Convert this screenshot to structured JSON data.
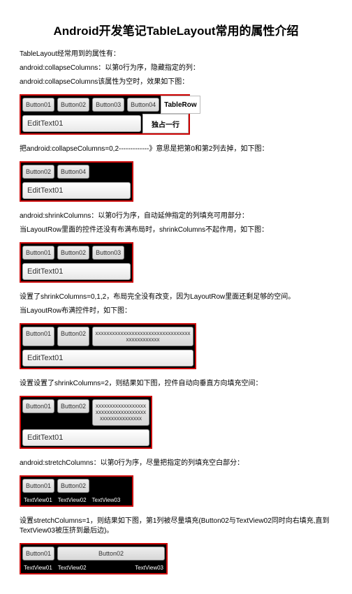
{
  "title": "Android开发笔记TableLayout常用的属性介绍",
  "p1": "TableLayout经常用到的属性有：",
  "p2": "android:collapseColumns：以第0行为序，隐藏指定的列：",
  "p3": "android:collapseColumns该属性为空时，效果如下图：",
  "demo1": {
    "btns": [
      "Button01",
      "Button02",
      "Button03",
      "Button04"
    ],
    "side1": "TableRow",
    "edit": "EditText01",
    "side2": "独占一行"
  },
  "p4": "把android:collapseColumns=0,2-------------》意思是把第0和第2列去掉，如下图：",
  "demo2": {
    "btns": [
      "Button02",
      "Button04"
    ],
    "edit": "EditText01"
  },
  "p5": "android:shrinkColumns：以第0行为序，自动延伸指定的列填充可用部分：",
  "p6": "当LayoutRow里面的控件还没有布满布局时，shrinkColumns不起作用，如下图：",
  "demo3": {
    "btns": [
      "Button01",
      "Button02",
      "Button03"
    ],
    "edit": "EditText01"
  },
  "p7": "设置了shrinkColumns=0,1,2，布局完全没有改变，因为LayoutRow里面还剩足够的空间。",
  "p8": "当LayoutRow布满控件时，如下图：",
  "demo4": {
    "btns": [
      "Button01",
      "Button02"
    ],
    "xcell": "xxxxxxxxxxxxxxxxxxxxxxxxxxxxxxxxxxxxxxxxxxxxxx",
    "edit": "EditText01"
  },
  "p9": "设置设置了shrinkColumns=2，则结果如下图，控件自动向垂直方向填充空间：",
  "demo5": {
    "btns": [
      "Button01",
      "Button02"
    ],
    "xcell": "xxxxxxxxxxxxxxxxxxxxxxxxxxxxxxxxxxxxxxxxxxxxxxxxxxx",
    "edit": "EditText01"
  },
  "p10": "android:stretchColumns：以第0行为序，尽量把指定的列填充空白部分：",
  "demo6": {
    "btns": [
      "Button01",
      "Button02"
    ],
    "tvs": [
      "TextView01",
      "TextView02",
      "TextView03"
    ]
  },
  "p11": "设置stretchColumns=1，则结果如下图，第1列被尽量填充(Button02与TextView02同时向右填充,直到TextView03被压挤到最后边)。",
  "demo7": {
    "btn1": "Button01",
    "btn2": "Button02",
    "tv1": "TextView01",
    "tv2": "TextView02",
    "tv3": "TextView03"
  }
}
